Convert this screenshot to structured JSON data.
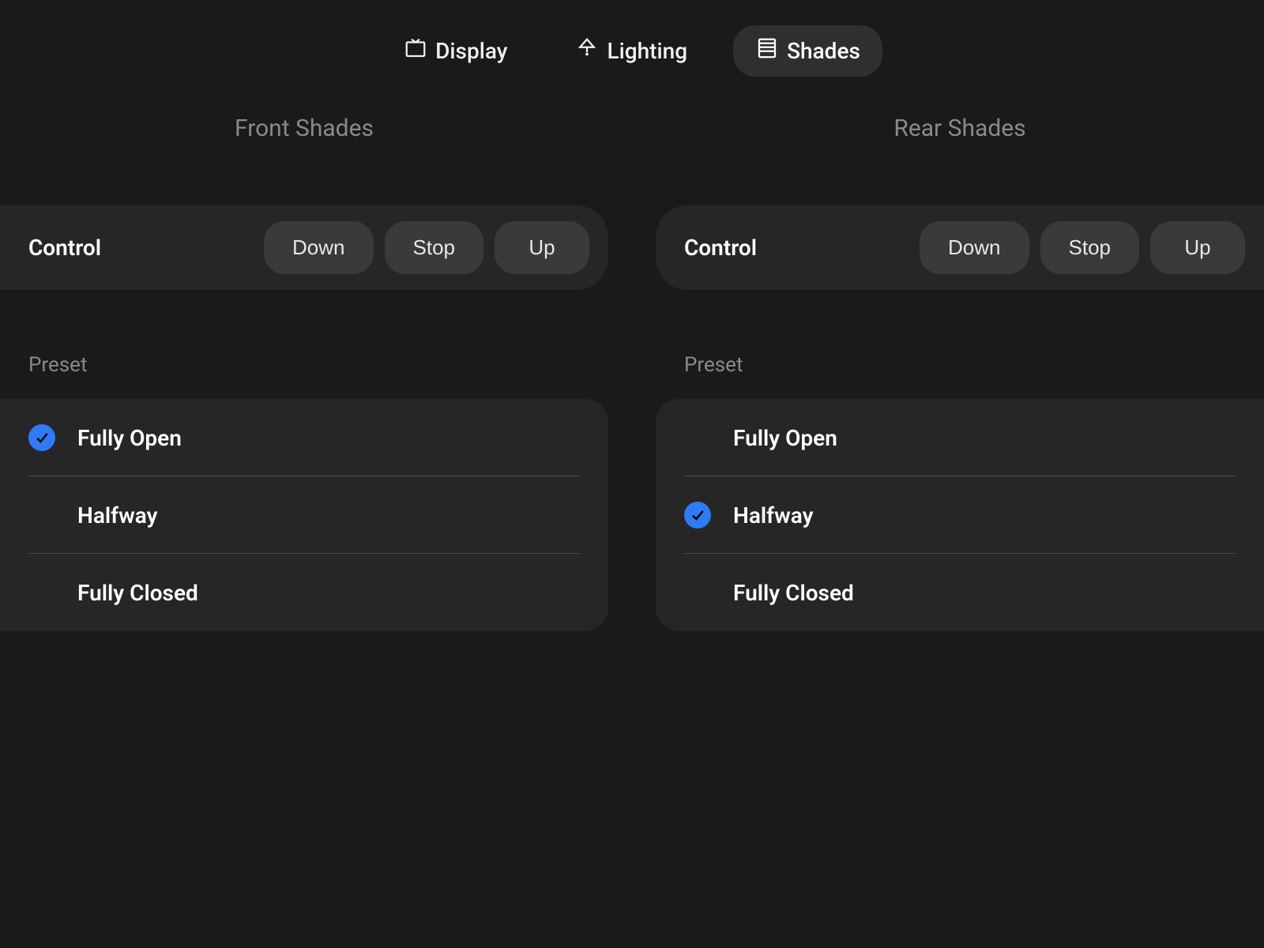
{
  "tabs": [
    {
      "label": "Display",
      "active": false
    },
    {
      "label": "Lighting",
      "active": false
    },
    {
      "label": "Shades",
      "active": true
    }
  ],
  "columns": [
    {
      "title": "Front Shades",
      "control_label": "Control",
      "buttons": [
        "Down",
        "Stop",
        "Up"
      ],
      "preset_label": "Preset",
      "presets": [
        {
          "label": "Fully Open",
          "selected": true
        },
        {
          "label": "Halfway",
          "selected": false
        },
        {
          "label": "Fully Closed",
          "selected": false
        }
      ]
    },
    {
      "title": "Rear Shades",
      "control_label": "Control",
      "buttons": [
        "Down",
        "Stop",
        "Up"
      ],
      "preset_label": "Preset",
      "presets": [
        {
          "label": "Fully Open",
          "selected": false
        },
        {
          "label": "Halfway",
          "selected": true
        },
        {
          "label": "Fully Closed",
          "selected": false
        }
      ]
    }
  ]
}
